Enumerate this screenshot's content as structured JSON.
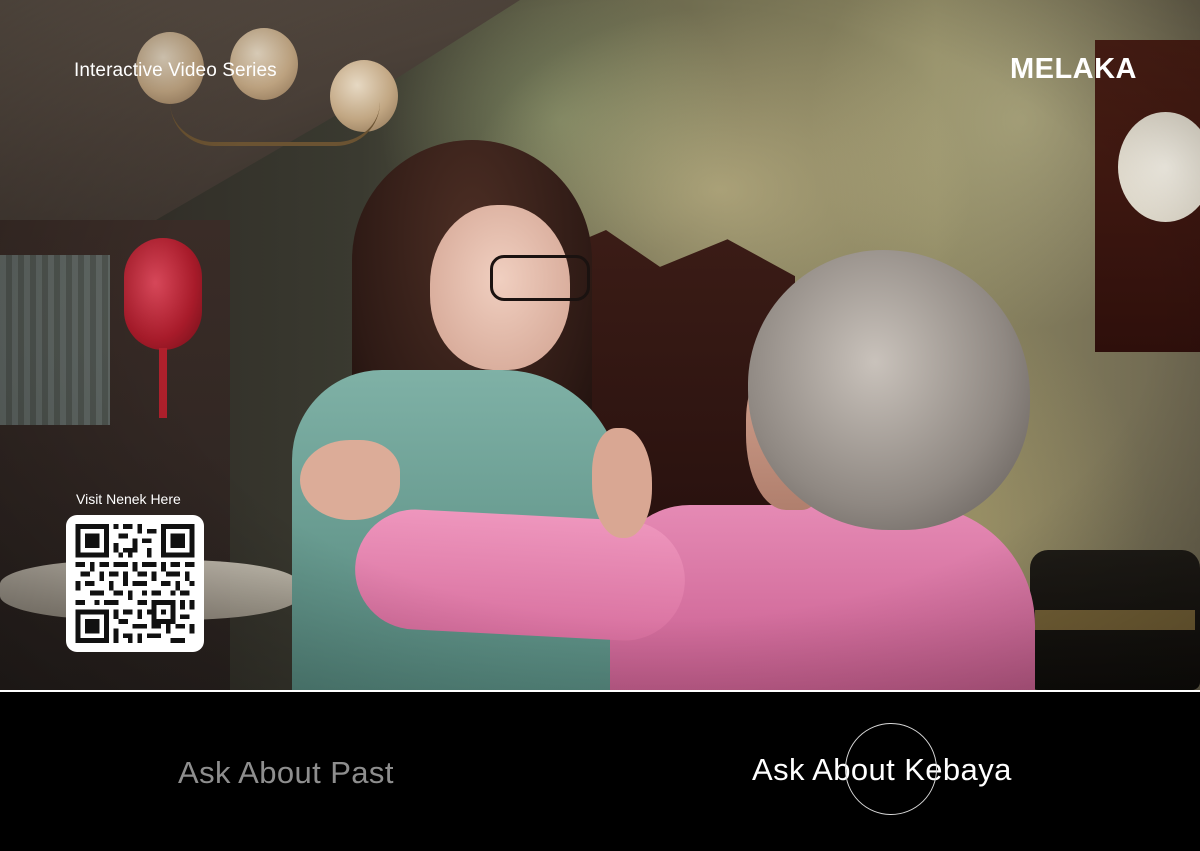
{
  "video": {
    "series_label": "Interactive Video Series",
    "brand": "MELAKA"
  },
  "qr": {
    "caption": "Visit Nenek Here",
    "icon": "qr-code-icon"
  },
  "choices": [
    {
      "label": "Ask About Past",
      "state": "inactive",
      "color": "#8e8e8e"
    },
    {
      "label": "Ask About Kebaya",
      "state": "hovered",
      "color": "#ffffff"
    }
  ],
  "colors": {
    "background": "#000000",
    "divider": "#ffffff",
    "text_primary": "#ffffff",
    "text_muted": "#8e8e8e"
  }
}
